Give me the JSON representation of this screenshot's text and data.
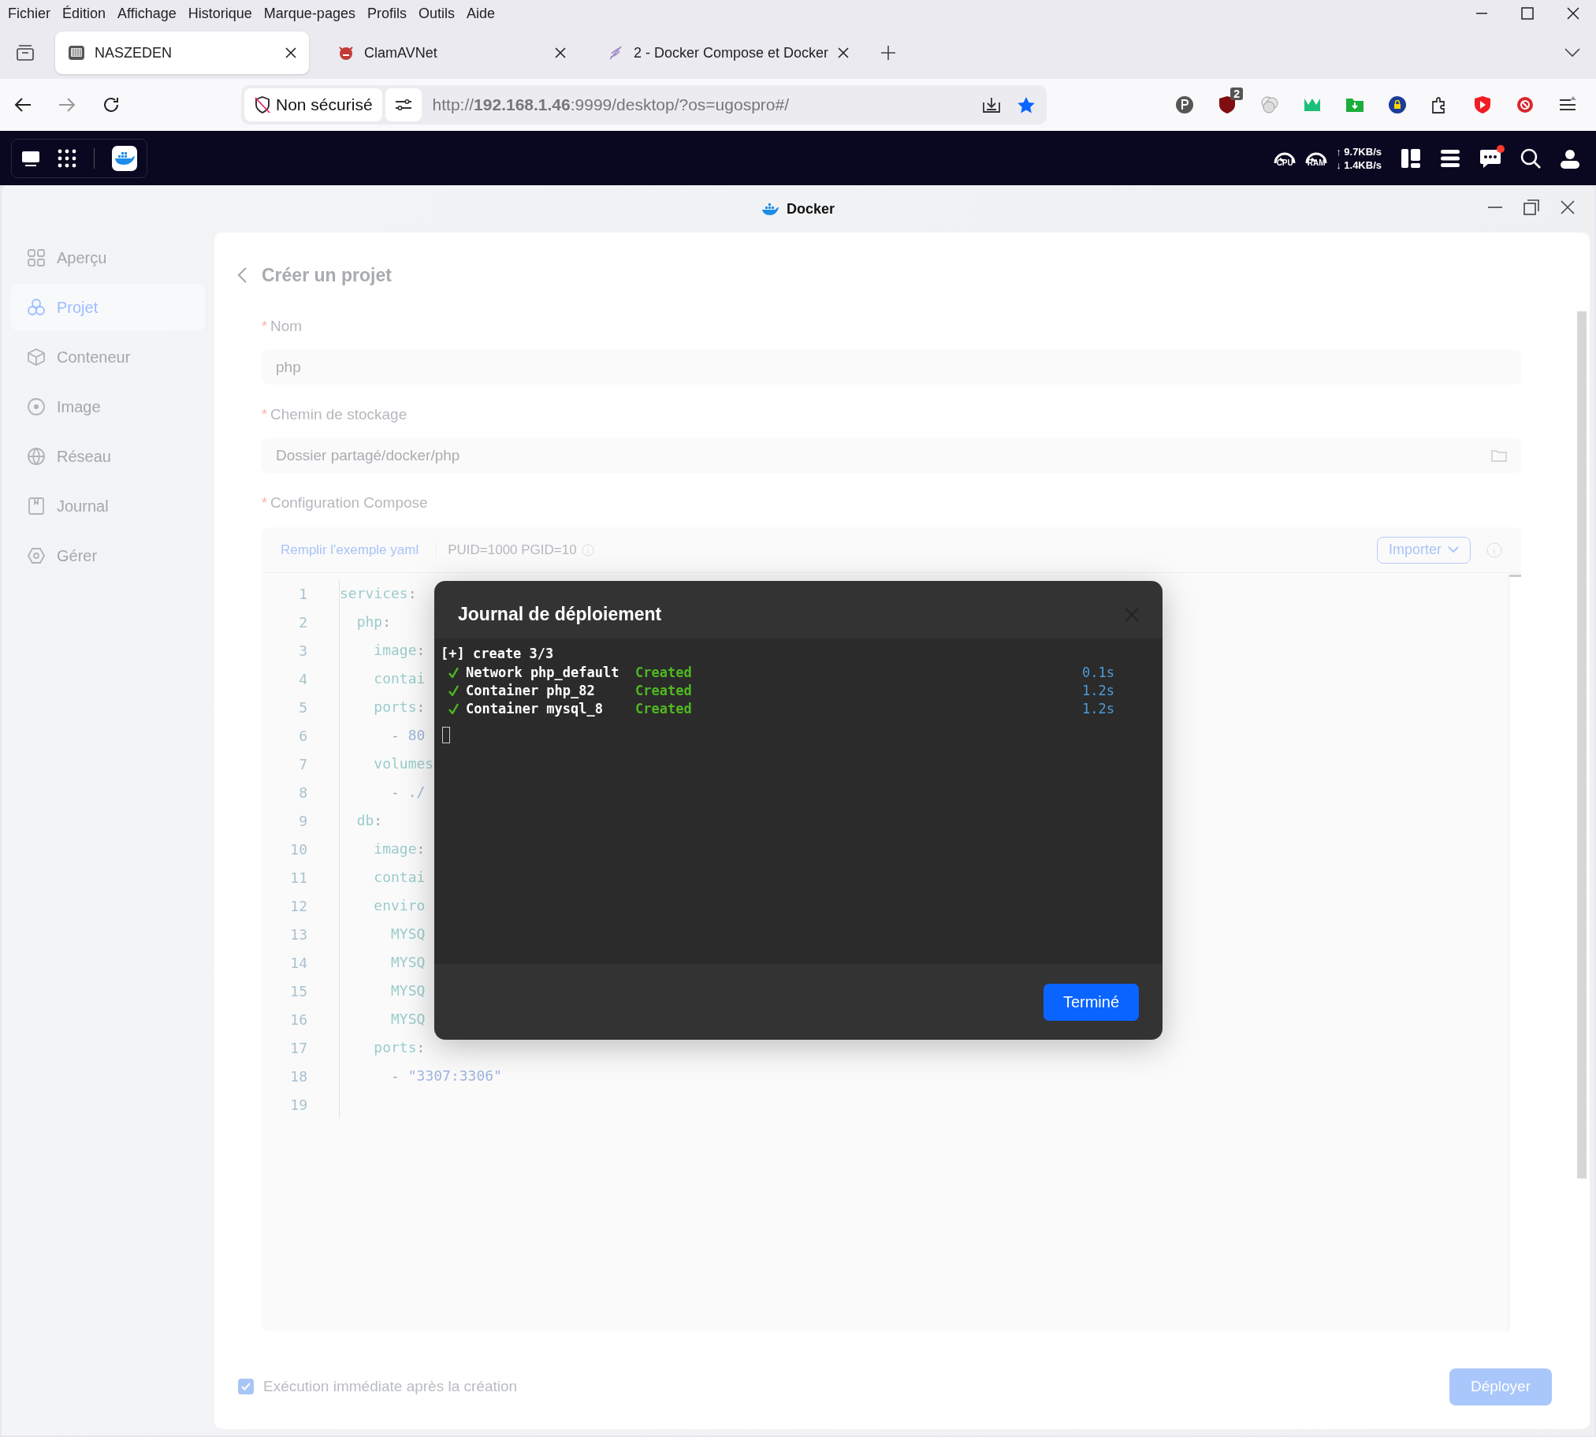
{
  "menu_bar": {
    "items": [
      "Fichier",
      "Édition",
      "Affichage",
      "Historique",
      "Marque-pages",
      "Profils",
      "Outils",
      "Aide"
    ]
  },
  "browser_tabs": [
    {
      "title": "NASZEDEN",
      "selected": true
    },
    {
      "title": "ClamAVNet",
      "selected": false
    },
    {
      "title": "2 - Docker Compose et Docker",
      "selected": false
    }
  ],
  "address_bar": {
    "security": "Non sécurisé",
    "url": "http://**192.168.1.46**:9999/desktop/?os=ugospro#/"
  },
  "extensions": [
    {
      "kind": "p"
    },
    {
      "kind": "shield",
      "badge": "2"
    },
    {
      "kind": "circles"
    },
    {
      "kind": "crown"
    },
    {
      "kind": "folder"
    },
    {
      "kind": "eu"
    },
    {
      "kind": "puzzle"
    },
    {
      "kind": "play"
    },
    {
      "kind": "block"
    },
    {
      "kind": "menu"
    }
  ],
  "nas_bar": {
    "cpu_label": "CPU",
    "ram_label": "RAM",
    "upload": "↑ 9.7KB/s",
    "download": "↓ 1.4KB/s",
    "notification": true
  },
  "window": {
    "title": "Docker"
  },
  "sidebar": {
    "items": [
      {
        "label": "Aperçu",
        "selected": false
      },
      {
        "label": "Projet",
        "selected": true
      },
      {
        "label": "Conteneur",
        "selected": false
      },
      {
        "label": "Image",
        "selected": false
      },
      {
        "label": "Réseau",
        "selected": false
      },
      {
        "label": "Journal",
        "selected": false
      },
      {
        "label": "Gérer",
        "selected": false
      }
    ]
  },
  "page": {
    "title": "Créer un projet",
    "fields": [
      {
        "label": "Nom",
        "required_mark": "*",
        "value": "php",
        "kind": "text"
      },
      {
        "label": "Chemin de stockage",
        "required_mark": "*",
        "value": "Dossier partagé/docker/php",
        "kind": "folder"
      }
    ],
    "compose": {
      "label": "Configuration Compose",
      "required_mark": "*",
      "fill_example": "Remplir l'exemple yaml",
      "ids_hint": "PUID=1000 PGID=10",
      "import_button": "Importer",
      "lines": [
        {
          "number": "1",
          "tokens": [
            {
              "kind": "key",
              "text": "services"
            },
            {
              "kind": "punct",
              "text": ":"
            }
          ]
        },
        {
          "number": "2",
          "tokens": [
            {
              "kind": "key",
              "text": "  php"
            },
            {
              "kind": "punct",
              "text": ":"
            }
          ]
        },
        {
          "number": "3",
          "tokens": [
            {
              "kind": "key",
              "text": "    image"
            },
            {
              "kind": "punct",
              "text": ":"
            }
          ]
        },
        {
          "number": "4",
          "tokens": [
            {
              "kind": "key",
              "text": "    contai"
            }
          ]
        },
        {
          "number": "5",
          "tokens": [
            {
              "kind": "key",
              "text": "    ports"
            },
            {
              "kind": "punct",
              "text": ":"
            }
          ]
        },
        {
          "number": "6",
          "tokens": [
            {
              "kind": "punct",
              "text": "      - "
            },
            {
              "kind": "string",
              "text": "80"
            }
          ]
        },
        {
          "number": "7",
          "tokens": [
            {
              "kind": "key",
              "text": "    volumes"
            }
          ]
        },
        {
          "number": "8",
          "tokens": [
            {
              "kind": "punct",
              "text": "      - "
            },
            {
              "kind": "string",
              "text": "./"
            }
          ]
        },
        {
          "number": "9",
          "tokens": [
            {
              "kind": "key",
              "text": "  db"
            },
            {
              "kind": "punct",
              "text": ":"
            }
          ]
        },
        {
          "number": "10",
          "tokens": [
            {
              "kind": "key",
              "text": "    image"
            },
            {
              "kind": "punct",
              "text": ":"
            }
          ]
        },
        {
          "number": "11",
          "tokens": [
            {
              "kind": "key",
              "text": "    contai"
            }
          ]
        },
        {
          "number": "12",
          "tokens": [
            {
              "kind": "key",
              "text": "    enviro"
            }
          ]
        },
        {
          "number": "13",
          "tokens": [
            {
              "kind": "key",
              "text": "      MYSQ"
            }
          ]
        },
        {
          "number": "14",
          "tokens": [
            {
              "kind": "key",
              "text": "      MYSQ"
            }
          ]
        },
        {
          "number": "15",
          "tokens": [
            {
              "kind": "key",
              "text": "      MYSQ"
            }
          ]
        },
        {
          "number": "16",
          "tokens": [
            {
              "kind": "key",
              "text": "      MYSQ"
            }
          ]
        },
        {
          "number": "17",
          "tokens": [
            {
              "kind": "key",
              "text": "    ports"
            },
            {
              "kind": "punct",
              "text": ":"
            }
          ]
        },
        {
          "number": "18",
          "tokens": [
            {
              "kind": "punct",
              "text": "      - "
            },
            {
              "kind": "string",
              "text": "\"3307:3306\""
            }
          ]
        },
        {
          "number": "19"
        }
      ]
    },
    "run_after_create": {
      "label": "Exécution immédiate après la création",
      "checked": true
    },
    "deploy_button": "Déployer"
  },
  "dialog": {
    "title": "Journal de déploiement",
    "header_line": "[+] create 3/3",
    "entries": [
      {
        "name": "Network php_default",
        "status": "Created",
        "time": "0.1s"
      },
      {
        "name": "Container php_82",
        "status": "Created",
        "time": "1.2s"
      },
      {
        "name": "Container mysql_8",
        "status": "Created",
        "time": "1.2s"
      }
    ],
    "done_button": "Terminé"
  }
}
